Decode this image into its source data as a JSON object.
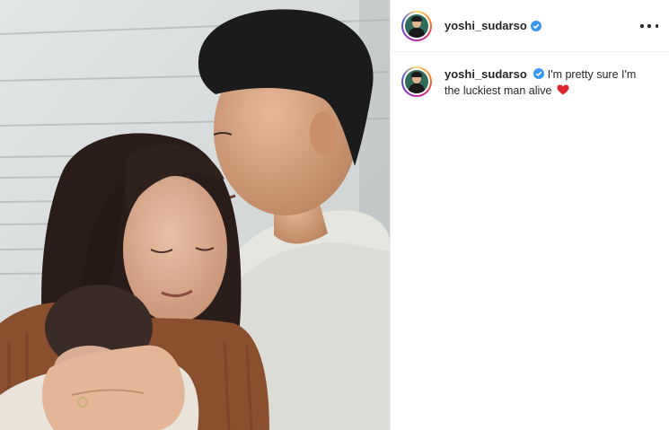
{
  "post": {
    "username": "yoshi_sudarso",
    "caption_line1": "I'm pretty sure I'm",
    "caption_line2": "the luckiest man alive"
  },
  "icons": {
    "verified": "verified-badge-icon",
    "more": "more-options-icon",
    "heart": "red-heart-emoji"
  },
  "colors": {
    "verified_blue": "#3897f0",
    "heart_red": "#e0242f",
    "story_ring": "#d62976"
  }
}
